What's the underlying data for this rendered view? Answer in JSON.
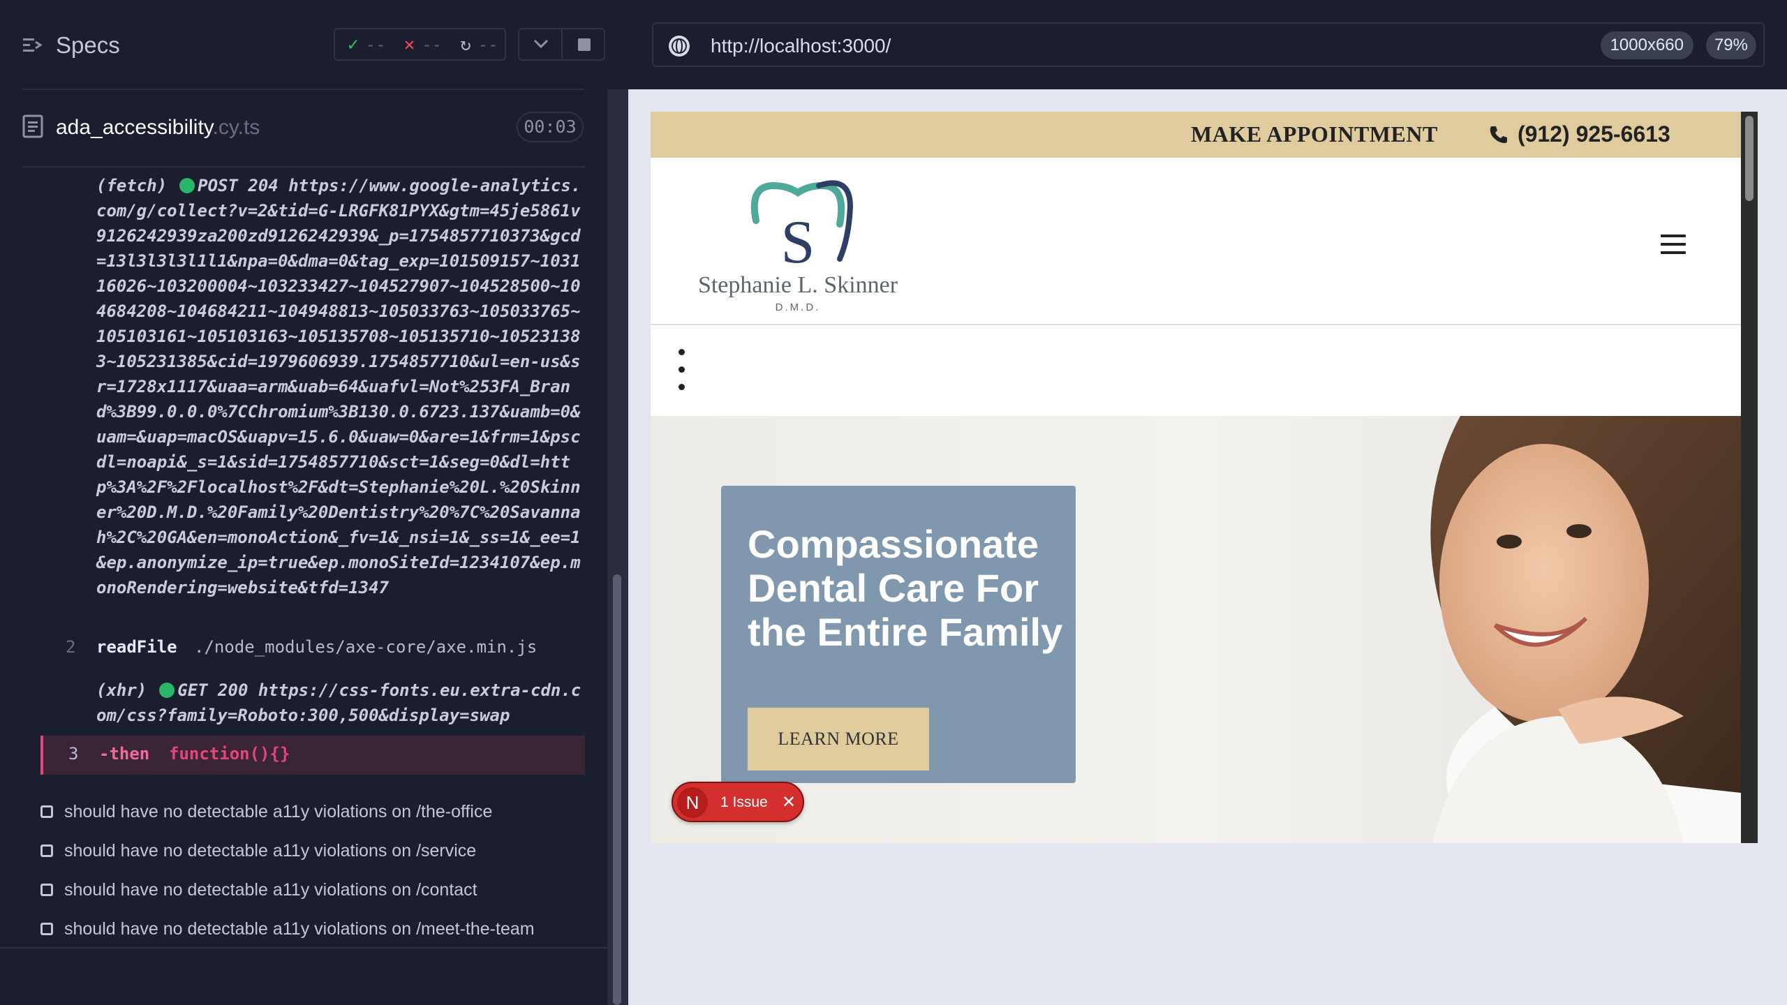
{
  "specs": {
    "title": "Specs",
    "stats": {
      "passed": "--",
      "failed": "--",
      "pending": "--"
    }
  },
  "file": {
    "name": "ada_accessibility",
    "ext": ".cy.ts",
    "time": "00:03"
  },
  "log": {
    "fetch_prefix": "(fetch)",
    "fetch_method": "POST 204",
    "fetch_url": "https://www.google-analytics.com/g/collect?v=2&tid=G-LRGFK81PYX&gtm=45je5861v9126242939za200zd9126242939&_p=1754857710373&gcd=13l3l3l3l1l1&npa=0&dma=0&tag_exp=101509157~103116026~103200004~103233427~104527907~104528500~104684208~104684211~104948813~105033763~105033765~105103161~105103163~105135708~105135710~105231383~105231385&cid=1979606939.1754857710&ul=en-us&sr=1728x1117&uaa=arm&uab=64&uafvl=Not%253FA_Brand%3B99.0.0.0%7CChromium%3B130.0.6723.137&uamb=0&uam=&uap=macOS&uapv=15.6.0&uaw=0&are=1&frm=1&pscdl=noapi&_s=1&sid=1754857710&sct=1&seg=0&dl=http%3A%2F%2Flocalhost%2F&dt=Stephanie%20L.%20Skinner%20D.M.D.%20Family%20Dentistry%20%7C%20Savannah%2C%20GA&en=monoAction&_fv=1&_nsi=1&_ss=1&_ee=1&ep.anonymize_ip=true&ep.monoSiteId=1234107&ep.monoRendering=website&tfd=1347",
    "row2": {
      "num": "2",
      "cmd": "readFile",
      "arg": "./node_modules/axe-core/axe.min.js"
    },
    "xhr_prefix": "(xhr)",
    "xhr_method": "GET 200",
    "xhr_url": "https://css-fonts.eu.extra-cdn.com/css?family=Roboto:300,500&display=swap",
    "row3": {
      "num": "3",
      "cmd": "-then",
      "arg": "function(){}"
    }
  },
  "tests": [
    "should have no detectable a11y violations on /the-office",
    "should have no detectable a11y violations on /service",
    "should have no detectable a11y violations on /contact",
    "should have no detectable a11y violations on /meet-the-team"
  ],
  "browser": {
    "url": "http://localhost:3000/",
    "viewport": "1000x660",
    "zoom": "79%"
  },
  "site": {
    "appointment": "MAKE APPOINTMENT",
    "phone": "(912) 925-6613",
    "logo_letter": "S",
    "logo_name": "Stephanie L. Skinner",
    "logo_dmd": "D.M.D.",
    "hero_title": "Compassionate Dental Care For the Entire Family",
    "hero_button": "LEARN MORE",
    "issue_logo": "N",
    "issue_text": "1 Issue",
    "issue_close": "✕"
  },
  "colors": {
    "accent_gold": "#dfcb9d",
    "hero_card": "#7992aa",
    "pass": "#20c95c",
    "fail": "#f04a5c",
    "badge_red": "#d32f2f"
  }
}
